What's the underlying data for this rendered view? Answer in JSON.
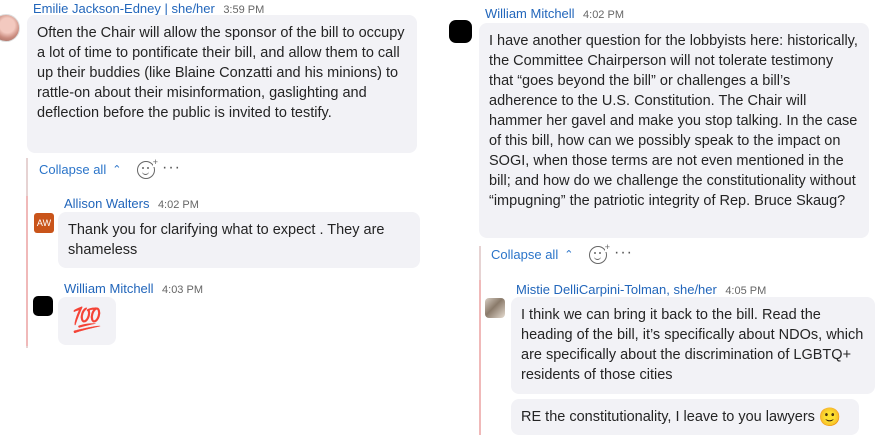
{
  "left_column": {
    "top_message": {
      "author": "Emilie Jackson-Edney | she/her",
      "time": "3:59 PM",
      "text": "Often the Chair will allow the sponsor of the bill to occupy a lot of time to pontificate their bill, and allow them to call up their buddies (like Blaine Conzatti and his minions) to rattle-on about their misinformation, gaslighting and deflection before the public is invited to testify."
    },
    "collapse_label": "Collapse all",
    "replies": [
      {
        "author": "Allison Walters",
        "time": "4:02 PM",
        "avatar_initials": "AW",
        "text": "Thank you for clarifying what to expect . They are shameless"
      },
      {
        "author": "William Mitchell",
        "time": "4:03 PM",
        "emoji": "💯"
      }
    ]
  },
  "right_column": {
    "top_message": {
      "author": "William Mitchell",
      "time": "4:02 PM",
      "text": "I have another question for the lobbyists here: historically, the Committee Chairperson will not tolerate testimony that “goes beyond the bill” or challenges a bill’s adherence to the U.S. Constitution.  The Chair will hammer her gavel and make you stop talking.  In the case of this bill, how can we possibly speak to the impact on SOGI, when those terms are not even mentioned in the bill; and how do we challenge the constitutionality without “impugning” the patriotic integrity of Rep. Bruce Skaug?"
    },
    "collapse_label": "Collapse all",
    "replies": [
      {
        "author": "Mistie DelliCarpini-Tolman, she/her",
        "time": "4:05 PM",
        "text": "I think we can bring it back to the bill. Read the heading of the bill, it’s specifically about NDOs, which are specifically about the discrimination of LGBTQ+ residents of those cities",
        "followup": "RE the constitutionality, I leave to you lawyers",
        "followup_emoji": "🙂"
      }
    ]
  },
  "icons": {
    "react": "smiley-add-icon",
    "more": "more-options-icon",
    "chevron": "chevron-up-icon"
  },
  "colors": {
    "author": "#2266bb",
    "link": "#2a74c9",
    "bubble": "#f2f2f6",
    "thread_line": "#f0b9b9",
    "aw_avatar": "#c9541a"
  }
}
